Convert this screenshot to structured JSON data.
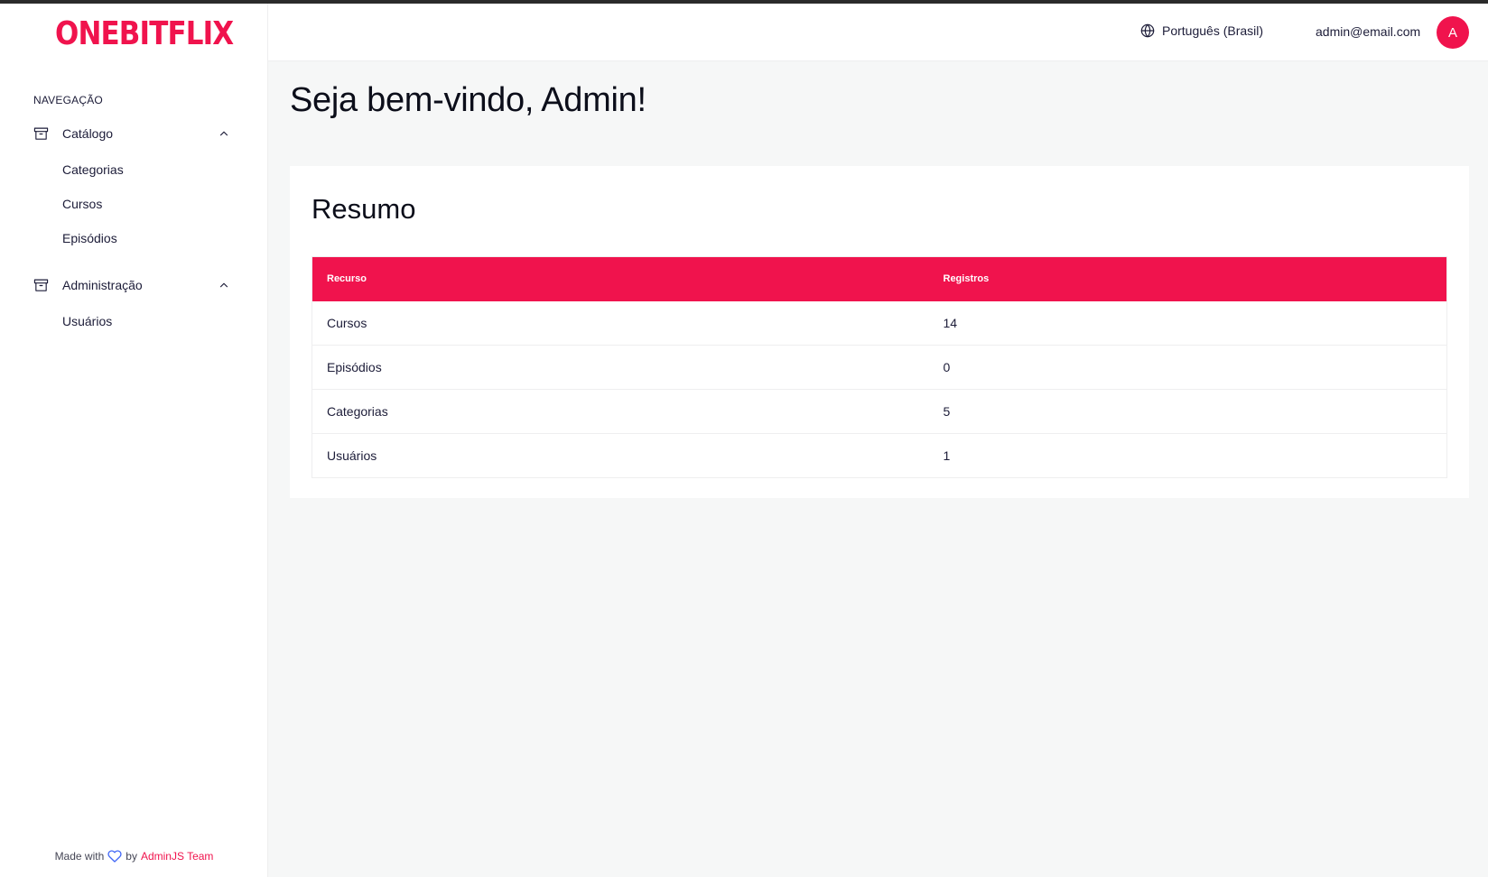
{
  "brand": {
    "logo_text": "ONEBITFLIX",
    "accent_color": "#f0134d"
  },
  "sidebar": {
    "heading": "NAVEGAÇÃO",
    "groups": [
      {
        "label": "Catálogo",
        "icon": "archive-icon",
        "expanded": true,
        "items": [
          {
            "label": "Categorias"
          },
          {
            "label": "Cursos"
          },
          {
            "label": "Episódios"
          }
        ]
      },
      {
        "label": "Administração",
        "icon": "archive-icon",
        "expanded": true,
        "items": [
          {
            "label": "Usuários"
          }
        ]
      }
    ],
    "footer": {
      "made_with": "Made with",
      "by": "by",
      "team": "AdminJS Team"
    }
  },
  "topbar": {
    "language": "Português (Brasil)",
    "user_email": "admin@email.com",
    "avatar_initial": "A"
  },
  "main": {
    "welcome": "Seja bem-vindo, Admin!",
    "summary": {
      "title": "Resumo",
      "columns": [
        "Recurso",
        "Registros"
      ],
      "rows": [
        {
          "resource": "Cursos",
          "count": "14"
        },
        {
          "resource": "Episódios",
          "count": "0"
        },
        {
          "resource": "Categorias",
          "count": "5"
        },
        {
          "resource": "Usuários",
          "count": "1"
        }
      ]
    }
  }
}
